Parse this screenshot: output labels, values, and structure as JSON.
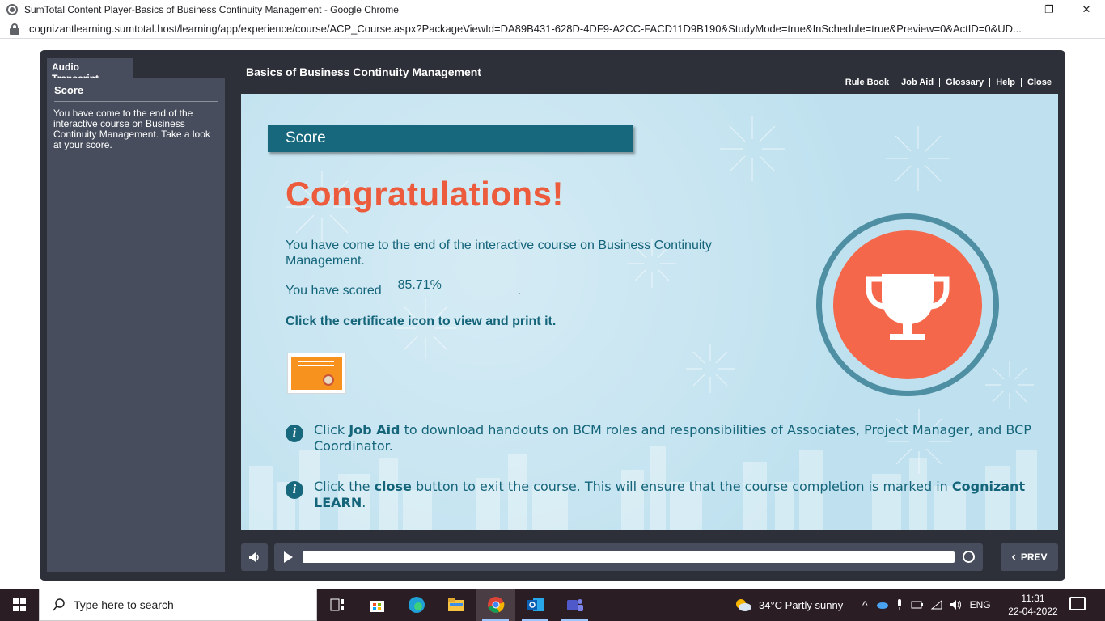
{
  "window": {
    "title": "SumTotal Content Player-Basics of Business Continuity Management - Google Chrome",
    "minimize_glyph": "—",
    "maximize_glyph": "❐",
    "close_glyph": "✕"
  },
  "address": {
    "url": "cognizantlearning.sumtotal.host/learning/app/experience/course/ACP_Course.aspx?PackageViewId=DA89B431-628D-4DF9-A2CC-FACD11D9B190&StudyMode=true&InSchedule=true&Preview=0&ActID=0&UD..."
  },
  "sidebar": {
    "tab_label": "Audio Transcript",
    "heading": "Score",
    "transcript": "You have come to the end of the interactive course on Business Continuity Management. Take a look at your score."
  },
  "header": {
    "course_title": "Basics of Business Continuity Management",
    "links": [
      "Rule Book",
      "Job Aid",
      "Glossary",
      "Help",
      "Close"
    ]
  },
  "slide": {
    "banner": "Score",
    "congrats": "Congratulations!",
    "end_text": "You have come to the end of the interactive course on Business Continuity Management.",
    "scored_label": "You have scored",
    "score_value": "85.71%",
    "scored_suffix": ".",
    "cert_instruction": "Click the certificate icon to view and print it.",
    "info1_pre": "Click ",
    "info1_bold": "Job Aid",
    "info1_post": " to download handouts on BCM roles and responsibilities of Associates, Project Manager, and BCP Coordinator.",
    "info2_pre": "Click the ",
    "info2_bold": "close",
    "info2_mid": " button to exit the course. This will ensure that the course completion is marked in ",
    "info2_bold2": "Cognizant LEARN",
    "info2_post": ".",
    "info_glyph": "i",
    "accent_color": "#ec5b3c",
    "text_color": "#15657a"
  },
  "controls": {
    "prev_label": "PREV",
    "prev_glyph": "‹",
    "progress_fraction": 1.0
  },
  "taskbar": {
    "search_placeholder": "Type here to search",
    "weather": "34°C  Partly sunny",
    "language": "ENG",
    "time": "11:31",
    "date": "22-04-2022"
  }
}
